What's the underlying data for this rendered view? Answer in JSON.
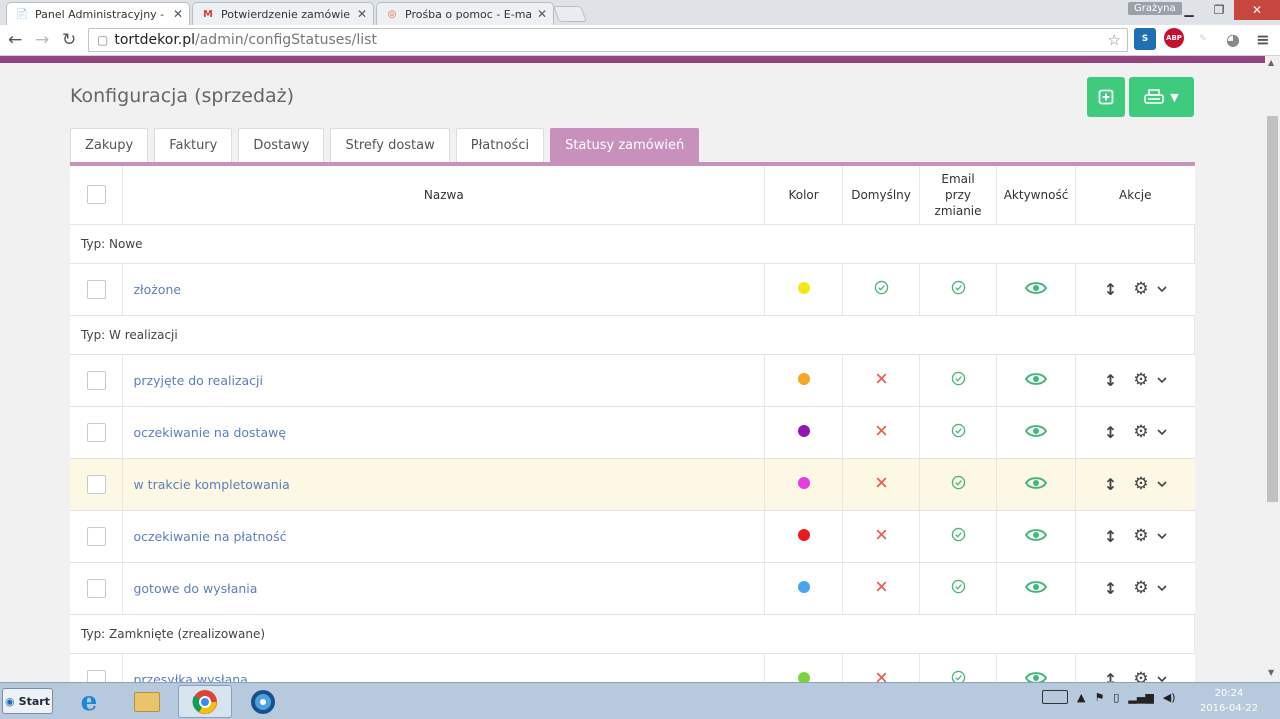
{
  "browser": {
    "tabs": [
      {
        "title": "Panel Administracyjny - S",
        "icon": "page-icon"
      },
      {
        "title": "Potwierdzenie zamówienia",
        "icon": "gmail-icon"
      },
      {
        "title": "Prośba o pomoc - E-maile",
        "icon": "lifebuoy-icon"
      }
    ],
    "user": "Grażyna",
    "url_domain": "tortdekor.pl",
    "url_path": "/admin/configStatuses/list",
    "extensions": [
      "S",
      "ABP"
    ]
  },
  "page": {
    "title": "Konfiguracja (sprzedaż)",
    "tabs": [
      "Zakupy",
      "Faktury",
      "Dostawy",
      "Strefy dostaw",
      "Płatności",
      "Statusy zamówień"
    ],
    "active_tab": "Statusy zamówień",
    "accent_color": "#c790bd",
    "columns": {
      "name": "Nazwa",
      "color": "Kolor",
      "default": "Domyślny",
      "email": "Email przy zmianie",
      "active": "Aktywność",
      "actions": "Akcje"
    },
    "groups": [
      {
        "label": "Typ: Nowe",
        "rows": [
          {
            "name": "złożone",
            "color": "#f7e617",
            "default": true,
            "email": true,
            "active": true
          }
        ]
      },
      {
        "label": "Typ: W realizacji",
        "rows": [
          {
            "name": "przyjęte do realizacji",
            "color": "#f5a623",
            "default": false,
            "email": true,
            "active": true
          },
          {
            "name": "oczekiwanie na dostawę",
            "color": "#8e17b5",
            "default": false,
            "email": true,
            "active": true
          },
          {
            "name": "w trakcie kompletowania",
            "color": "#e53de0",
            "default": false,
            "email": true,
            "active": true,
            "highlighted": true
          },
          {
            "name": "oczekiwanie na płatność",
            "color": "#e81c1c",
            "default": false,
            "email": true,
            "active": true
          },
          {
            "name": "gotowe do wysłania",
            "color": "#4aa3ee",
            "default": false,
            "email": true,
            "active": true
          }
        ]
      },
      {
        "label": "Typ: Zamknięte (zrealizowane)",
        "rows": [
          {
            "name": "przesyłka wysłana",
            "color": "#7ed13a",
            "default": false,
            "email": true,
            "active": true
          }
        ]
      }
    ]
  },
  "taskbar": {
    "start": "Start",
    "time": "20:24",
    "date": "2016-04-22"
  }
}
